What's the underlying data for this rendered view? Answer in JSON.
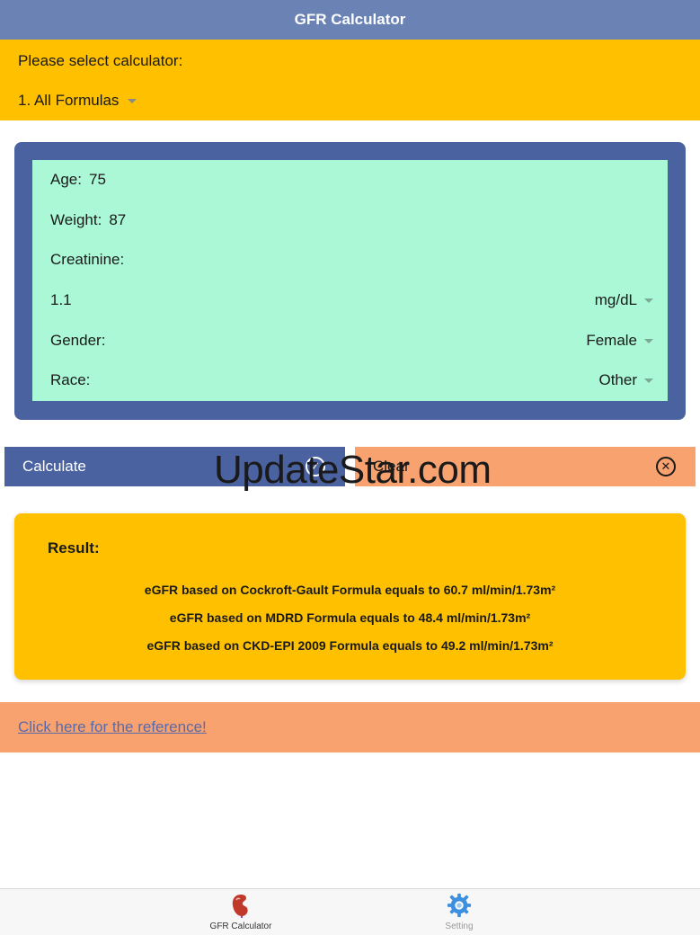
{
  "navbar": {
    "title": "GFR Calculator"
  },
  "selector": {
    "prompt": "Please select calculator:",
    "selected": "1. All Formulas"
  },
  "form": {
    "age_label": "Age:",
    "age_value": "75",
    "weight_label": "Weight:",
    "weight_value": "87",
    "creatinine_label": "Creatinine:",
    "creatinine_value": "1.1",
    "creatinine_unit": "mg/dL",
    "gender_label": "Gender:",
    "gender_value": "Female",
    "race_label": "Race:",
    "race_value": "Other"
  },
  "buttons": {
    "calculate": "Calculate",
    "clear": "Clear"
  },
  "watermark": "UpdateStar.com",
  "result": {
    "title": "Result:",
    "lines": [
      "eGFR based on Cockroft-Gault Formula equals to 60.7 ml/min/1.73m²",
      "eGFR based on MDRD Formula equals to 48.4 ml/min/1.73m²",
      "eGFR based on CKD-EPI 2009 Formula equals to 49.2 ml/min/1.73m²"
    ]
  },
  "reference": {
    "link": "Click here for the reference!"
  },
  "tabbar": {
    "tabs": [
      {
        "label": "GFR Calculator",
        "icon": "kidney-icon"
      },
      {
        "label": "Setting",
        "icon": "gear-icon"
      }
    ]
  },
  "colors": {
    "navbar": "#6a82b4",
    "accent_yellow": "#ffc000",
    "form_frame": "#4a62a0",
    "form_inner": "#aaf8d6",
    "clear_orange": "#f8a270"
  }
}
